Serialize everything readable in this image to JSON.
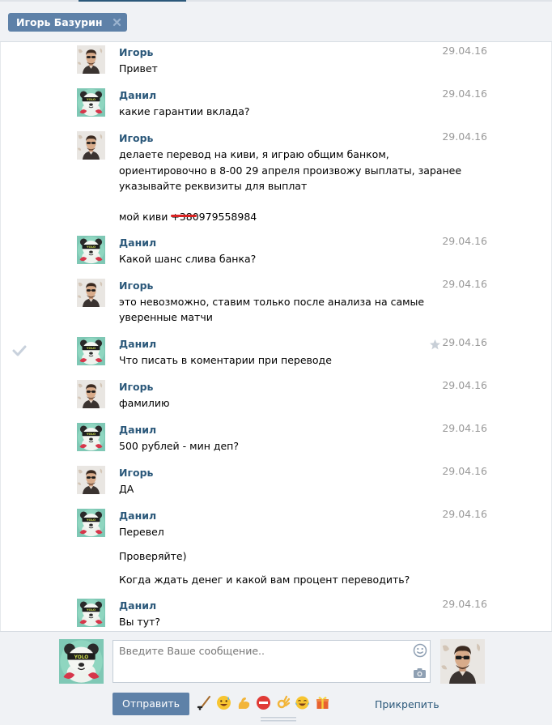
{
  "header": {
    "chat_title": "Игорь Базурин",
    "close_icon": "close-icon"
  },
  "messages": [
    {
      "author": "Игорь",
      "date": "29.04.16",
      "lines": [
        "Привет"
      ]
    },
    {
      "author": "Данил",
      "date": "29.04.16",
      "lines": [
        "какие гарантии вклада?"
      ]
    },
    {
      "author": "Игорь",
      "date": "29.04.16",
      "lines": [
        "делаете перевод на киви, я играю общим банком,",
        "ориентировочно в 8-00 29 апреля произвожу выплаты, заранее",
        "указывайте реквизиты для выплат"
      ],
      "extra_prefix": "мой киви ",
      "extra_redacted": "+380",
      "extra_suffix": "979558984"
    },
    {
      "author": "Данил",
      "date": "29.04.16",
      "lines": [
        "Какой шанс слива банка?"
      ]
    },
    {
      "author": "Игорь",
      "date": "29.04.16",
      "lines": [
        "это невозможно, ставим только после анализа на самые",
        "уверенные матчи"
      ]
    },
    {
      "author": "Данил",
      "date": "29.04.16",
      "lines": [
        "Что писать в коментарии при переводе"
      ]
    },
    {
      "author": "Игорь",
      "date": "29.04.16",
      "lines": [
        "фамилию"
      ]
    },
    {
      "author": "Данил",
      "date": "29.04.16",
      "lines": [
        "500 рублей - мин деп?"
      ]
    },
    {
      "author": "Игорь",
      "date": "29.04.16",
      "lines": [
        "ДА"
      ]
    },
    {
      "author": "Данил",
      "date": "29.04.16",
      "lines": [
        "Перевел",
        "Проверяйте)",
        "Когда ждать денег и какой вам процент переводить?"
      ]
    },
    {
      "author": "Данил",
      "date": "29.04.16",
      "lines": [
        "Вы тут?"
      ]
    }
  ],
  "composer": {
    "placeholder": "Введите Ваше сообщение..",
    "send_label": "Отправить",
    "attach_label": "Прикрепить",
    "emoji": [
      "hockey-stick-emoji",
      "sweat-smile-emoji",
      "flexed-biceps-emoji",
      "no-entry-emoji",
      "ok-hand-emoji",
      "tears-of-joy-emoji",
      "gift-emoji"
    ]
  },
  "colors": {
    "accent": "#5e81a8",
    "author_link": "#2b587a",
    "date": "#999999",
    "redaction": "#d92323"
  }
}
